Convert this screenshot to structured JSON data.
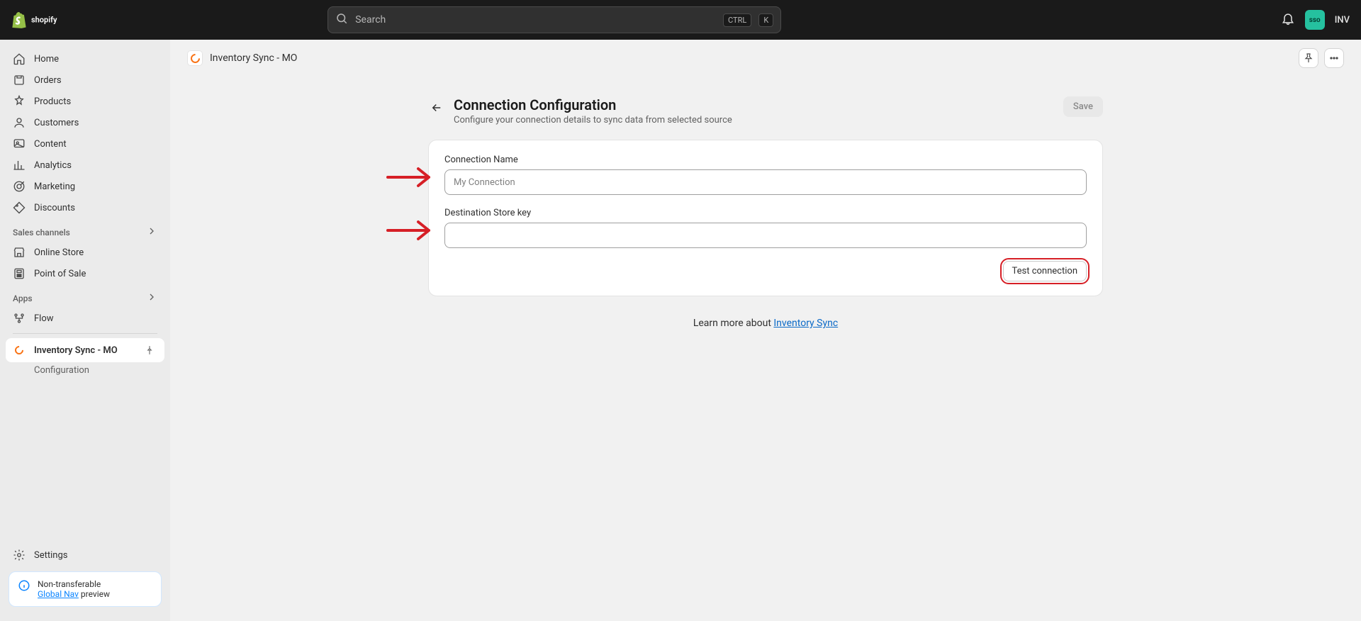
{
  "topbar": {
    "search_placeholder": "Search",
    "kbd1": "CTRL",
    "kbd2": "K",
    "avatar_initials": "sso",
    "store_name": "INV"
  },
  "sidebar": {
    "main": [
      {
        "label": "Home"
      },
      {
        "label": "Orders"
      },
      {
        "label": "Products"
      },
      {
        "label": "Customers"
      },
      {
        "label": "Content"
      },
      {
        "label": "Analytics"
      },
      {
        "label": "Marketing"
      },
      {
        "label": "Discounts"
      }
    ],
    "channels_title": "Sales channels",
    "channels": [
      {
        "label": "Online Store"
      },
      {
        "label": "Point of Sale"
      }
    ],
    "apps_title": "Apps",
    "apps": [
      {
        "label": "Flow"
      }
    ],
    "active_app_label": "Inventory Sync - MO",
    "active_app_sub": "Configuration",
    "settings_label": "Settings",
    "alert_line1": "Non-transferable",
    "alert_link": "Global Nav",
    "alert_rest": " preview"
  },
  "titlebar": {
    "title": "Inventory Sync - MO"
  },
  "page": {
    "heading": "Connection Configuration",
    "subheading": "Configure your connection details to sync data from selected source",
    "save_label": "Save",
    "field1_label": "Connection Name",
    "field1_placeholder": "My Connection",
    "field2_label": "Destination Store key",
    "test_label": "Test connection",
    "learn_text": "Learn more about ",
    "learn_link": "Inventory Sync"
  }
}
